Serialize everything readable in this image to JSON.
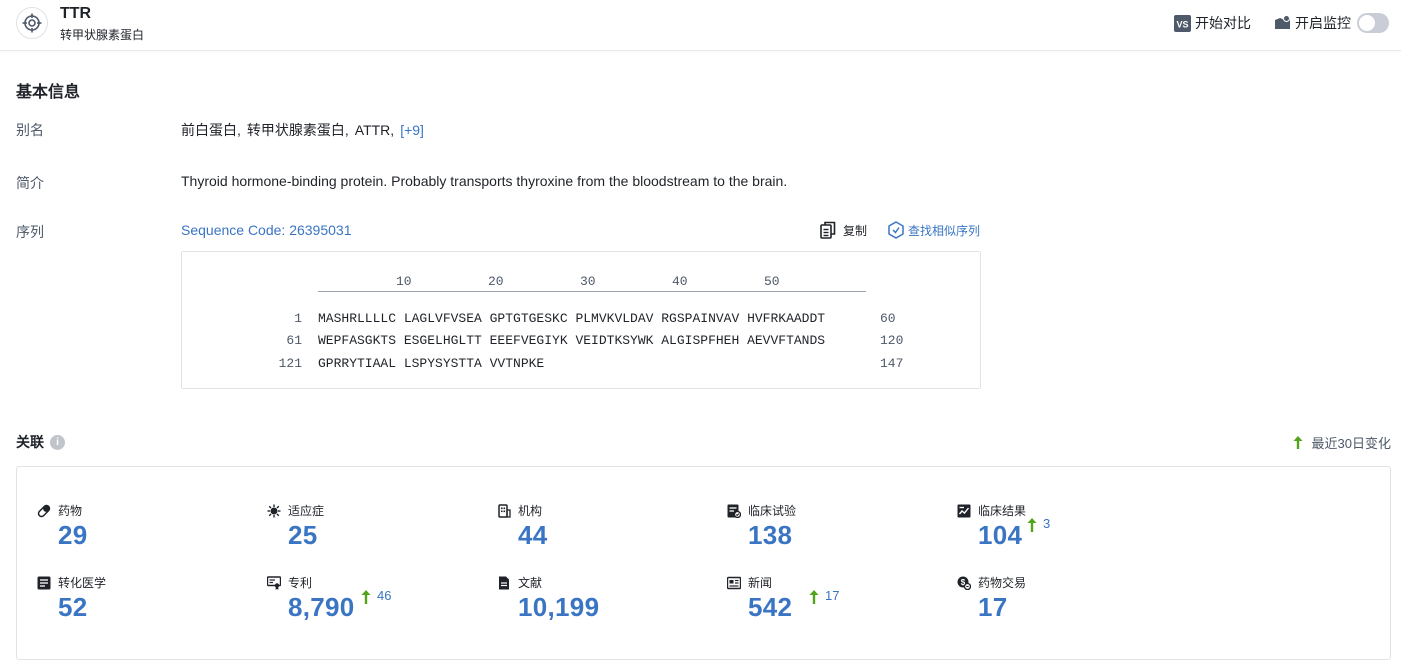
{
  "header": {
    "title": "TTR",
    "subtitle": "转甲状腺素蛋白",
    "compare_label": "开始对比",
    "compare_badge": "VS",
    "monitor_label": "开启监控"
  },
  "basic_info": {
    "section_title": "基本信息",
    "alias": {
      "label": "别名",
      "items": [
        "前白蛋白,",
        "转甲状腺素蛋白,",
        "ATTR,"
      ],
      "more_label": "[+9]"
    },
    "summary": {
      "label": "简介",
      "text": "Thyroid hormone-binding protein. Probably transports thyroxine from the bloodstream to the brain."
    },
    "sequence": {
      "label": "序列",
      "code_label": "Sequence Code: 26395031",
      "copy_label": "复制",
      "find_similar_label": "查找相似序列",
      "ruler": [
        "10",
        "20",
        "30",
        "40",
        "50"
      ],
      "rows": [
        {
          "start": "1",
          "seq": "MASHRLLLLC LAGLVFVSEA GPTGTGESKC PLMVKVLDAV RGSPAINVAV HVFRKAADDT",
          "end": "60"
        },
        {
          "start": "61",
          "seq": "WEPFASGKTS ESGELHGLTT EEEFVEGIYK VEIDTKSYWK ALGISPFHEH AEVVFTANDS",
          "end": "120"
        },
        {
          "start": "121",
          "seq": "GPRRYTIAAL LSPYSYSTTA VVTNPKE",
          "end": "147"
        }
      ]
    }
  },
  "relations": {
    "section_title": "关联",
    "info_glyph": "i",
    "recent_change_label": "最近30日变化",
    "accent_color": "#3a75c4",
    "up_color": "#52a51a",
    "stats": [
      {
        "label": "药物",
        "icon": "pill-icon",
        "value": "29"
      },
      {
        "label": "适应症",
        "icon": "virus-icon",
        "value": "25"
      },
      {
        "label": "机构",
        "icon": "building-icon",
        "value": "44"
      },
      {
        "label": "临床试验",
        "icon": "clinical-trial-icon",
        "value": "138"
      },
      {
        "label": "临床结果",
        "icon": "clinical-result-icon",
        "value": "104",
        "delta": "3"
      },
      {
        "label": "转化医学",
        "icon": "translational-icon",
        "value": "52"
      },
      {
        "label": "专利",
        "icon": "patent-icon",
        "value": "8,790",
        "delta": "46"
      },
      {
        "label": "文献",
        "icon": "document-icon",
        "value": "10,199"
      },
      {
        "label": "新闻",
        "icon": "news-icon",
        "value": "542",
        "delta": "17"
      },
      {
        "label": "药物交易",
        "icon": "deal-icon",
        "value": "17"
      }
    ]
  }
}
